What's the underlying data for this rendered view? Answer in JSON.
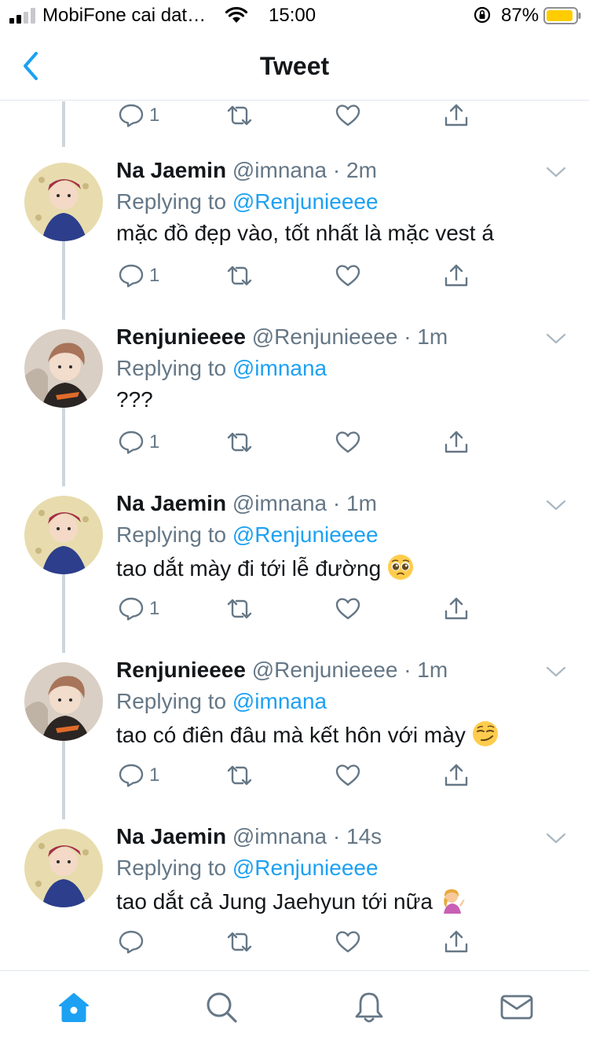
{
  "status_bar": {
    "carrier": "MobiFone cai dat…",
    "time": "15:00",
    "battery": "87%"
  },
  "nav": {
    "title": "Tweet"
  },
  "top_actions": {
    "reply_count": "1"
  },
  "tweets": [
    {
      "name": "Na Jaemin",
      "handle": "@imnana",
      "dot": "·",
      "time": "2m",
      "replying_prefix": "Replying to ",
      "replying_to": "@Renjunieeee",
      "text": "mặc đồ đẹp vào, tốt nhất là mặc vest á",
      "emoji": "",
      "reply_count": "1"
    },
    {
      "name": "Renjunieeee",
      "handle": "@Renjunieeee",
      "dot": "·",
      "time": "1m",
      "replying_prefix": "Replying to ",
      "replying_to": "@imnana",
      "text": "???",
      "emoji": "",
      "reply_count": "1"
    },
    {
      "name": "Na Jaemin",
      "handle": "@imnana",
      "dot": "·",
      "time": "1m",
      "replying_prefix": "Replying to ",
      "replying_to": "@Renjunieeee",
      "text": "tao dắt mày đi tới lễ đường",
      "emoji": "pleading-face",
      "reply_count": "1"
    },
    {
      "name": "Renjunieeee",
      "handle": "@Renjunieeee",
      "dot": "·",
      "time": "1m",
      "replying_prefix": "Replying to ",
      "replying_to": "@imnana",
      "text": "tao có điên đâu mà kết hôn với mày",
      "emoji": "smirking-face",
      "reply_count": "1"
    },
    {
      "name": "Na Jaemin",
      "handle": "@imnana",
      "dot": "·",
      "time": "14s",
      "replying_prefix": "Replying to ",
      "replying_to": "@Renjunieeee",
      "text": "tao dắt cả Jung Jaehyun tới nữa",
      "emoji": "person-tipping-hand",
      "reply_count": ""
    }
  ],
  "icons": {
    "reply": "reply-icon",
    "retweet": "retweet-icon",
    "like": "heart-icon",
    "share": "share-icon",
    "home": "home-icon",
    "search": "search-icon",
    "notifications": "bell-icon",
    "messages": "envelope-icon"
  },
  "colors": {
    "accent": "#1da1f2",
    "text": "#14171a",
    "secondary": "#657786",
    "divider": "#e1e8ed",
    "thread_line": "#ccd6dd"
  }
}
